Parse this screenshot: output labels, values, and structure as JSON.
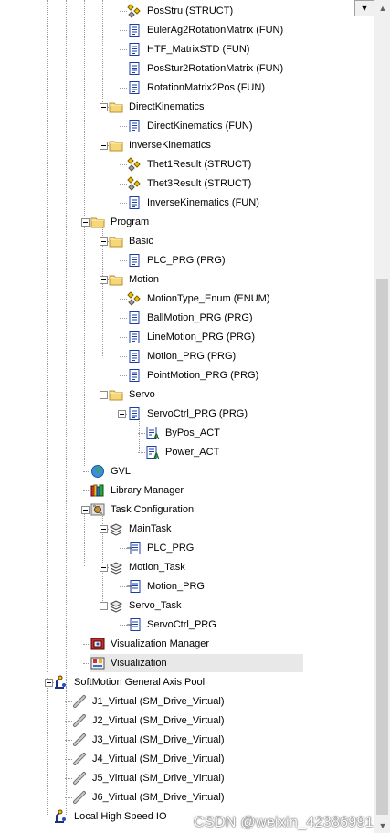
{
  "tree": {
    "rows": [
      {
        "label": "PosStru (STRUCT)",
        "icon": "struct-icon"
      },
      {
        "label": "EulerAg2RotationMatrix (FUN)",
        "icon": "function-icon"
      },
      {
        "label": "HTF_MatrixSTD (FUN)",
        "icon": "function-icon"
      },
      {
        "label": "PosStur2RotationMatrix (FUN)",
        "icon": "function-icon"
      },
      {
        "label": "RotationMatrix2Pos (FUN)",
        "icon": "function-icon"
      },
      {
        "label": "DirectKinematics",
        "icon": "folder-icon"
      },
      {
        "label": "DirectKinematics (FUN)",
        "icon": "function-icon"
      },
      {
        "label": "InverseKinematics",
        "icon": "folder-icon"
      },
      {
        "label": "Thet1Result (STRUCT)",
        "icon": "struct-icon"
      },
      {
        "label": "Thet3Result (STRUCT)",
        "icon": "struct-icon"
      },
      {
        "label": "InverseKinematics (FUN)",
        "icon": "function-icon"
      },
      {
        "label": "Program",
        "icon": "folder-icon"
      },
      {
        "label": "Basic",
        "icon": "folder-icon"
      },
      {
        "label": "PLC_PRG (PRG)",
        "icon": "program-icon"
      },
      {
        "label": "Motion",
        "icon": "folder-icon"
      },
      {
        "label": "MotionType_Enum (ENUM)",
        "icon": "struct-icon"
      },
      {
        "label": "BallMotion_PRG (PRG)",
        "icon": "program-icon"
      },
      {
        "label": "LineMotion_PRG (PRG)",
        "icon": "program-icon"
      },
      {
        "label": "Motion_PRG (PRG)",
        "icon": "program-icon"
      },
      {
        "label": "PointMotion_PRG (PRG)",
        "icon": "program-icon"
      },
      {
        "label": "Servo",
        "icon": "folder-icon"
      },
      {
        "label": "ServoCtrl_PRG (PRG)",
        "icon": "program-icon"
      },
      {
        "label": "ByPos_ACT",
        "icon": "action-icon"
      },
      {
        "label": "Power_ACT",
        "icon": "action-icon"
      },
      {
        "label": "GVL",
        "icon": "globe-icon"
      },
      {
        "label": "Library Manager",
        "icon": "library-icon"
      },
      {
        "label": "Task Configuration",
        "icon": "task-config-icon"
      },
      {
        "label": "MainTask",
        "icon": "task-icon"
      },
      {
        "label": "PLC_PRG",
        "icon": "program-call-icon"
      },
      {
        "label": "Motion_Task",
        "icon": "task-icon"
      },
      {
        "label": "Motion_PRG",
        "icon": "program-call-icon"
      },
      {
        "label": "Servo_Task",
        "icon": "task-icon"
      },
      {
        "label": "ServoCtrl_PRG",
        "icon": "program-call-icon"
      },
      {
        "label": "Visualization Manager",
        "icon": "visu-manager-icon"
      },
      {
        "label": "Visualization",
        "icon": "visualization-icon"
      },
      {
        "label": "SoftMotion General Axis Pool",
        "icon": "axis-pool-icon"
      },
      {
        "label": "J1_Virtual (SM_Drive_Virtual)",
        "icon": "axis-icon"
      },
      {
        "label": "J2_Virtual (SM_Drive_Virtual)",
        "icon": "axis-icon"
      },
      {
        "label": "J3_Virtual (SM_Drive_Virtual)",
        "icon": "axis-icon"
      },
      {
        "label": "J4_Virtual (SM_Drive_Virtual)",
        "icon": "axis-icon"
      },
      {
        "label": "J5_Virtual (SM_Drive_Virtual)",
        "icon": "axis-icon"
      },
      {
        "label": "J6_Virtual (SM_Drive_Virtual)",
        "icon": "axis-icon"
      },
      {
        "label": "Local High Speed IO",
        "icon": "axis-pool-icon"
      }
    ]
  },
  "watermark": "CSDN @weixin_42386991",
  "colors": {
    "selected_bg": "#e8e8e8",
    "folder": "#f5d77a",
    "prog_blue": "#1a3ea8"
  }
}
